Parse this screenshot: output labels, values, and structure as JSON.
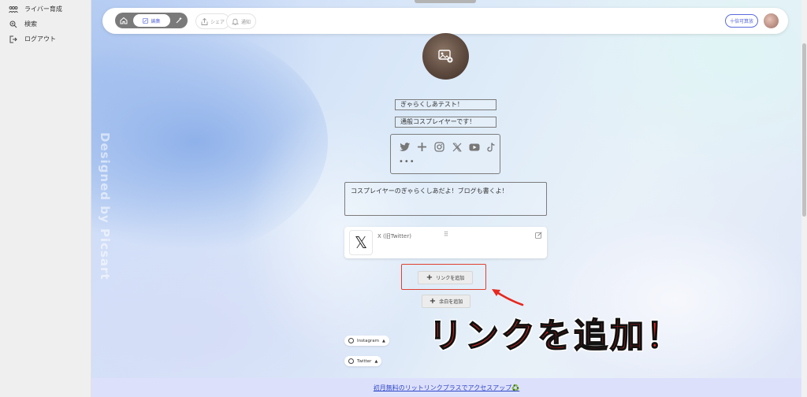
{
  "sidebar": {
    "items": [
      {
        "label": "ライバー育成",
        "icon": "people-icon"
      },
      {
        "label": "検索",
        "icon": "search-icon"
      },
      {
        "label": "ログアウト",
        "icon": "logout-icon"
      }
    ]
  },
  "toolbar": {
    "edit_label": "編集",
    "share_label": "シェア",
    "notify_label": "通知",
    "upgrade_label": "十倍可算放"
  },
  "profile": {
    "name": "ぎゃらくしあテスト！",
    "subtitle": "通般コスプレイヤーです！",
    "more_label": "•••",
    "bio": "コスプレイヤーのぎゃらくしあだよ！ブログも書くよ！"
  },
  "social_icons": [
    "twitter-icon",
    "plus-icon",
    "instagram-icon",
    "x-icon",
    "youtube-icon",
    "tiktok-icon"
  ],
  "link_card": {
    "icon_glyph": "𝕏",
    "title": "X (旧Twitter)",
    "drag_glyph": "⠿"
  },
  "buttons": {
    "add_link": "リンクを追加",
    "add_space": "余白を追加"
  },
  "annotation": "リンクを追加！",
  "watermark": "Designed by Picsart",
  "chips": [
    {
      "label": "Instagram"
    },
    {
      "label": "Twitter"
    }
  ],
  "banner": "初月無料のリットリンクプラスでアクセスアップ♻️",
  "colors": {
    "accent": "#5b6bdc",
    "highlight": "#e04030",
    "annotation": "#e8271e",
    "banner_bg": "#dde0fb"
  }
}
